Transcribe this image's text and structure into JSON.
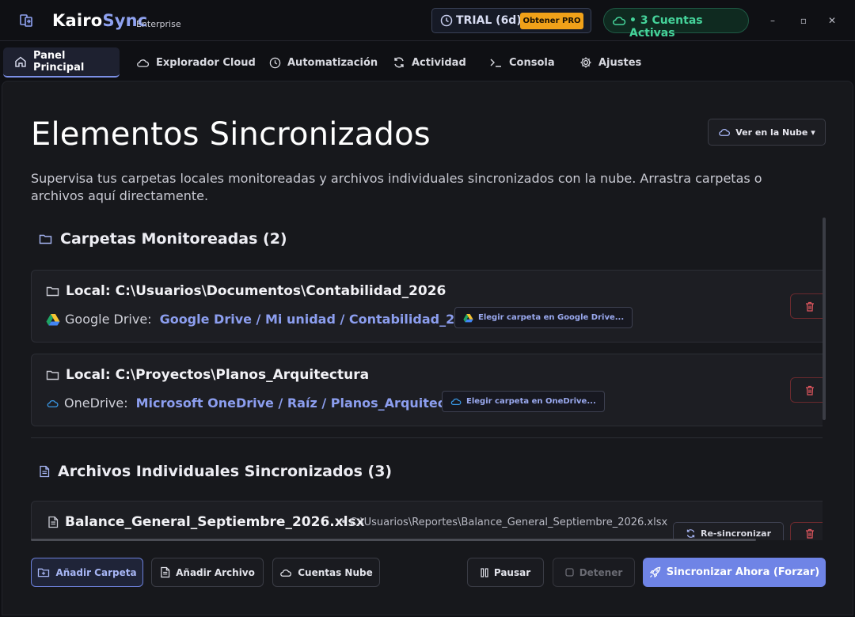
{
  "app": {
    "brand_main": "Kairo",
    "brand_accent": "Sync",
    "edition": "Enterprise",
    "trial_label": "TRIAL (6d)",
    "pro_button": "Obtener PRO",
    "accounts_label": "3 Cuentas Activas",
    "window_controls": {
      "minimize": "–",
      "maximize": "▫",
      "close": "✕"
    }
  },
  "tabs": [
    {
      "label": "Panel Principal",
      "icon": "home-icon",
      "active": true
    },
    {
      "label": "Explorador Cloud",
      "icon": "cloud-icon"
    },
    {
      "label": "Automatización",
      "icon": "clock-icon"
    },
    {
      "label": "Actividad",
      "icon": "refresh-icon"
    },
    {
      "label": "Consola",
      "icon": "terminal-icon"
    },
    {
      "label": "Ajustes",
      "icon": "gear-icon"
    }
  ],
  "main": {
    "title": "Elementos Sincronizados",
    "cloud_view_button": "Ver en la Nube ▾",
    "subtitle": "Supervisa tus carpetas locales monitoreadas y archivos individuales sincronizados con la nube. Arrastra carpetas o archivos aquí directamente."
  },
  "folders_section": {
    "title": "Carpetas Monitoreadas (2)",
    "items": [
      {
        "local": "Local: C:\\Usuarios\\Documentos\\Contabilidad_2026",
        "provider": "Google Drive:",
        "cloud_path": "Google Drive / Mi unidad / Contabilidad_2026",
        "choose_button": "Elegir carpeta en Google Drive..."
      },
      {
        "local": "Local: C:\\Proyectos\\Planos_Arquitectura",
        "provider": "OneDrive:",
        "cloud_path": "Microsoft OneDrive / Raíz / Planos_Arquitectura",
        "choose_button": "Elegir carpeta en OneDrive..."
      }
    ]
  },
  "files_section": {
    "title": "Archivos Individuales Sincronizados (3)",
    "items": [
      {
        "name": "Balance_General_Septiembre_2026.xlsx",
        "path": "• C:\\Usuarios\\Reportes\\Balance_General_Septiembre_2026.xlsx",
        "resync_button": "Re-sincronizar"
      }
    ]
  },
  "bottom_bar": {
    "add_folder": "Añadir Carpeta",
    "add_file": "Añadir Archivo",
    "cloud_accounts": "Cuentas Nube",
    "pause": "Pausar",
    "stop": "Detener",
    "sync_now": "Sincronizar Ahora (Forzar)"
  },
  "colors": {
    "accent": "#7b8fe6",
    "pro": "#f0a119",
    "active_green": "#45d39a",
    "danger": "#e0565e"
  }
}
